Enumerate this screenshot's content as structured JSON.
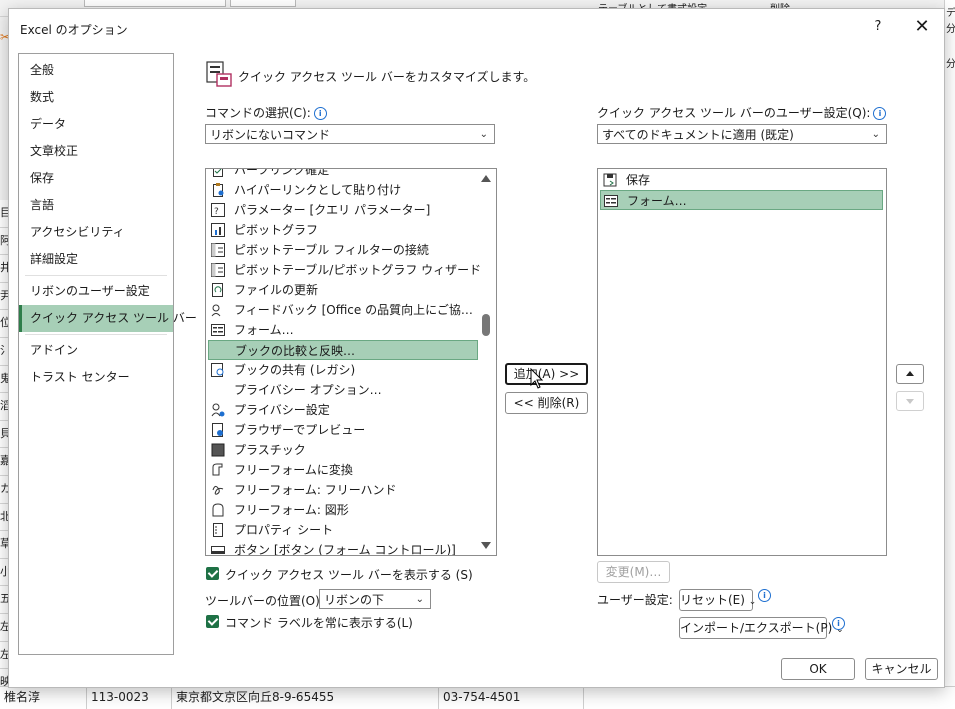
{
  "background": {
    "left_cells": [
      "目",
      "阿",
      "井",
      "尹",
      "位",
      "氵",
      "鬼",
      "滔",
      "貝",
      "嘉",
      "カ",
      "北",
      "草",
      "小",
      "五",
      "左",
      "左",
      "映"
    ],
    "right_cells": [
      "デ",
      "分",
      "分"
    ],
    "bottom_row": [
      "椎名淳",
      "113-0023",
      "東京都文京区向丘8-9-65455",
      "03-754-4501"
    ],
    "toolbar_fragments": [
      "テーブルとして書式設定",
      "削除"
    ]
  },
  "dialog": {
    "title": "Excel のオプション",
    "help_label": "?",
    "close_label": "✕"
  },
  "nav": {
    "items": [
      {
        "label": "全般"
      },
      {
        "label": "数式"
      },
      {
        "label": "データ"
      },
      {
        "label": "文章校正"
      },
      {
        "label": "保存"
      },
      {
        "label": "言語"
      },
      {
        "label": "アクセシビリティ"
      },
      {
        "label": "詳細設定"
      },
      {
        "label": "リボンのユーザー設定"
      },
      {
        "label": "クイック アクセス ツール バー",
        "active": true
      },
      {
        "label": "アドイン"
      },
      {
        "label": "トラスト センター"
      }
    ]
  },
  "main": {
    "heading": "クイック アクセス ツール バーをカスタマイズします。",
    "commands_label": "コマンドの選択(C):",
    "commands_select": "リボンにないコマンド",
    "qat_label": "クイック アクセス ツール バーのユーザー設定(Q):",
    "qat_select": "すべてのドキュメントに適用 (既定)",
    "command_list": [
      {
        "label": "ハーフリンク確定",
        "icon": "document-check-icon"
      },
      {
        "label": "ハイパーリンクとして貼り付け",
        "icon": "paste-link-icon"
      },
      {
        "label": "パラメーター [クエリ パラメーター]",
        "icon": "parameter-icon"
      },
      {
        "label": "ピボットグラフ",
        "icon": "pivot-chart-icon"
      },
      {
        "label": "ピボットテーブル フィルターの接続",
        "icon": "pivot-filter-icon"
      },
      {
        "label": "ピボットテーブル/ピボットグラフ ウィザード",
        "icon": "pivot-wizard-icon"
      },
      {
        "label": "ファイルの更新",
        "icon": "file-refresh-icon"
      },
      {
        "label": "フィードバック [Office の品質向上にご協…",
        "icon": "feedback-icon"
      },
      {
        "label": "フォーム…",
        "icon": "form-icon"
      },
      {
        "label": "ブックの比較と反映…",
        "icon": "",
        "selected": true
      },
      {
        "label": "ブックの共有 (レガシ)",
        "icon": "share-workbook-icon"
      },
      {
        "label": "プライバシー オプション…",
        "icon": ""
      },
      {
        "label": "プライバシー設定",
        "icon": "privacy-icon"
      },
      {
        "label": "ブラウザーでプレビュー",
        "icon": "browser-preview-icon"
      },
      {
        "label": "プラスチック",
        "icon": "plastic-icon"
      },
      {
        "label": "フリーフォームに変換",
        "icon": "freeform-convert-icon"
      },
      {
        "label": "フリーフォーム: フリーハンド",
        "icon": "freehand-icon"
      },
      {
        "label": "フリーフォーム: 図形",
        "icon": "freeform-shape-icon"
      },
      {
        "label": "プロパティ シート",
        "icon": "property-sheet-icon"
      },
      {
        "label": "ボタン [ボタン (フォーム コントロール)]",
        "icon": "button-control-icon"
      }
    ],
    "qat_list": [
      {
        "label": "保存",
        "icon": "save-icon"
      },
      {
        "label": "フォーム…",
        "icon": "form-icon",
        "selected": true
      }
    ],
    "add_button": "追加(A) >>",
    "remove_button": "<< 削除(R)",
    "show_qat_checkbox": "クイック アクセス ツール バーを表示する (S)",
    "toolbar_position_label": "ツールバーの位置(O)",
    "toolbar_position_select": "リボンの下",
    "always_show_labels_checkbox": "コマンド ラベルを常に表示する(L)",
    "modify_button": "変更(M)…",
    "customizations_label": "ユーザー設定:",
    "reset_button": "リセット(E)",
    "import_export_button": "インポート/エクスポート(P)",
    "ok_button": "OK",
    "cancel_button": "キャンセル"
  },
  "colors": {
    "selection": "#a7cfb7",
    "checkbox": "#1e7145",
    "info": "#1e6fd0"
  }
}
